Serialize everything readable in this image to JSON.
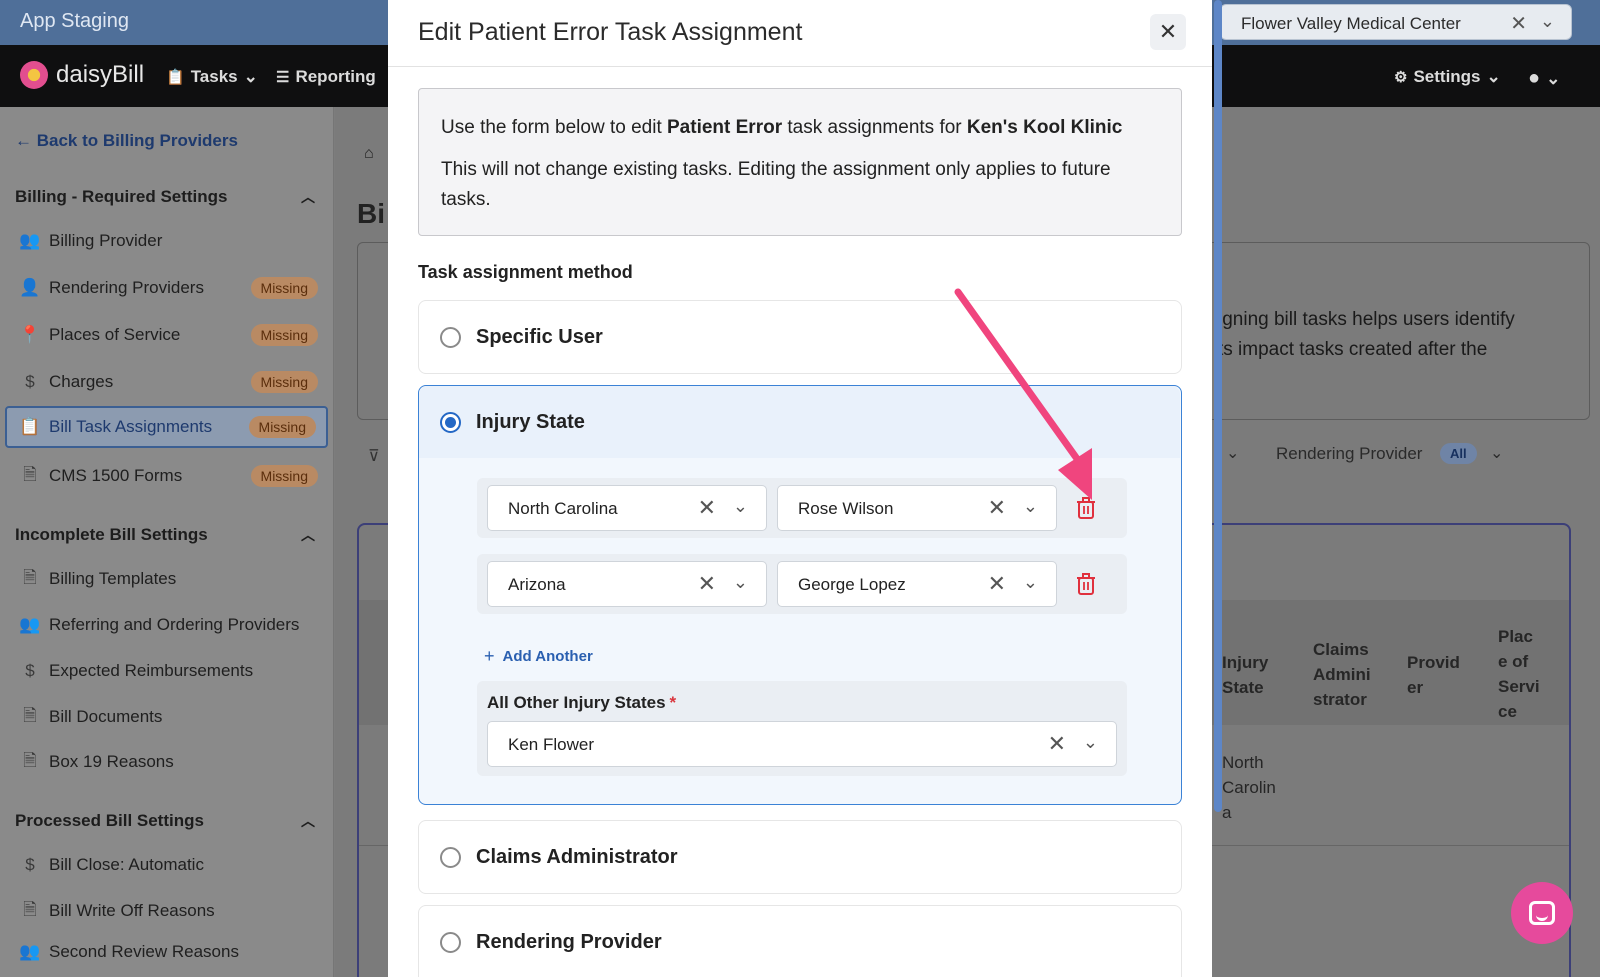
{
  "staging": {
    "title": "App Staging",
    "facility_value": "Flower Valley Medical Center"
  },
  "nav": {
    "logo_text": "daisyBill",
    "tasks": "Tasks",
    "reporting": "Reporting",
    "settings": "Settings"
  },
  "sidebar": {
    "back_label": "Back to Billing Providers",
    "sections": [
      {
        "title": "Billing - Required Settings",
        "items": [
          {
            "label": "Billing Provider",
            "icon": "users-icon",
            "badge": ""
          },
          {
            "label": "Rendering Providers",
            "icon": "provider-icon",
            "badge": "Missing"
          },
          {
            "label": "Places of Service",
            "icon": "map-pin-icon",
            "badge": "Missing"
          },
          {
            "label": "Charges",
            "icon": "dollar-icon",
            "badge": "Missing"
          },
          {
            "label": "Bill Task Assignments",
            "icon": "clipboard-icon",
            "badge": "Missing"
          },
          {
            "label": "CMS 1500 Forms",
            "icon": "document-icon",
            "badge": "Missing"
          }
        ]
      },
      {
        "title": "Incomplete Bill Settings",
        "items": [
          {
            "label": "Billing Templates",
            "icon": "document-icon"
          },
          {
            "label": "Referring and Ordering Providers",
            "icon": "users-icon"
          },
          {
            "label": "Expected Reimbursements",
            "icon": "dollar-icon"
          },
          {
            "label": "Bill Documents",
            "icon": "document-icon"
          },
          {
            "label": "Box 19 Reasons",
            "icon": "document-icon"
          }
        ]
      },
      {
        "title": "Processed Bill Settings",
        "items": [
          {
            "label": "Bill Close: Automatic",
            "icon": "dollar-icon"
          },
          {
            "label": "Bill Write Off Reasons",
            "icon": "document-icon"
          },
          {
            "label": "Second Review Reasons",
            "icon": "users-icon"
          }
        ]
      }
    ]
  },
  "main": {
    "heading_partial": "Bi",
    "info_line1": "igning bill tasks helps users identify",
    "info_line2": "ts impact tasks created after the",
    "filter_label": "Rendering Provider",
    "filter_badge": "All",
    "table_headers": [
      "Injury State",
      "Claims Admini strator",
      "Provid er",
      "Plac e of Servi ce"
    ],
    "table_cell": "North Carolin a"
  },
  "modal": {
    "title": "Edit Patient Error Task Assignment",
    "notice_prefix": "Use the form below to edit ",
    "notice_bold1": "Patient Error",
    "notice_mid": " task assignments for ",
    "notice_bold2": "Ken's Kool Klinic",
    "notice_line2": "This will not change existing tasks. Editing the assignment only applies to future tasks.",
    "method_label": "Task assignment method",
    "options": {
      "specific_user": "Specific User",
      "injury_state": "Injury State",
      "claims_admin": "Claims Administrator",
      "rendering_provider": "Rendering Provider"
    },
    "selected_option": "Injury State",
    "rules": [
      {
        "state": "North Carolina",
        "user": "Rose Wilson"
      },
      {
        "state": "Arizona",
        "user": "George Lopez"
      }
    ],
    "add_another": "Add Another",
    "other_label": "All Other Injury States",
    "other_required": "*",
    "other_value": "Ken Flower"
  },
  "colors": {
    "accent": "#2468c5",
    "trash": "#e0303d",
    "annotation_arrow": "#f0457e",
    "chat": "#e64a9c"
  }
}
